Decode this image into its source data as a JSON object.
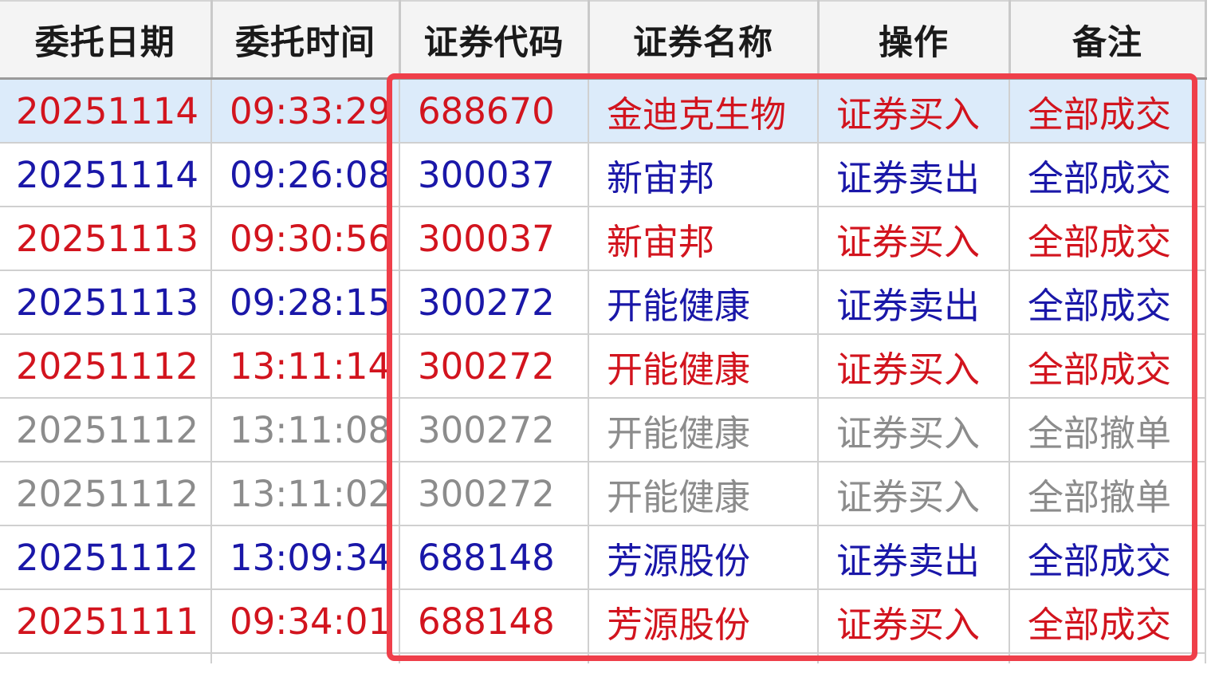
{
  "table": {
    "headers": [
      "委托日期",
      "委托时间",
      "证券代码",
      "证券名称",
      "操作",
      "备注"
    ],
    "rows": [
      {
        "date": "20251114",
        "time": "09:33:29",
        "code": "688670",
        "name": "金迪克生物",
        "action": "证券买入",
        "remark": "全部成交",
        "color": "red",
        "selected": true
      },
      {
        "date": "20251114",
        "time": "09:26:08",
        "code": "300037",
        "name": "新宙邦",
        "action": "证券卖出",
        "remark": "全部成交",
        "color": "blue"
      },
      {
        "date": "20251113",
        "time": "09:30:56",
        "code": "300037",
        "name": "新宙邦",
        "action": "证券买入",
        "remark": "全部成交",
        "color": "red"
      },
      {
        "date": "20251113",
        "time": "09:28:15",
        "code": "300272",
        "name": "开能健康",
        "action": "证券卖出",
        "remark": "全部成交",
        "color": "blue"
      },
      {
        "date": "20251112",
        "time": "13:11:14",
        "code": "300272",
        "name": "开能健康",
        "action": "证券买入",
        "remark": "全部成交",
        "color": "red"
      },
      {
        "date": "20251112",
        "time": "13:11:08",
        "code": "300272",
        "name": "开能健康",
        "action": "证券买入",
        "remark": "全部撤单",
        "color": "gray"
      },
      {
        "date": "20251112",
        "time": "13:11:02",
        "code": "300272",
        "name": "开能健康",
        "action": "证券买入",
        "remark": "全部撤单",
        "color": "gray"
      },
      {
        "date": "20251112",
        "time": "13:09:34",
        "code": "688148",
        "name": "芳源股份",
        "action": "证券卖出",
        "remark": "全部成交",
        "color": "blue"
      },
      {
        "date": "20251111",
        "time": "09:34:01",
        "code": "688148",
        "name": "芳源股份",
        "action": "证券买入",
        "remark": "全部成交",
        "color": "red"
      }
    ]
  },
  "colors": {
    "buy_red": "#d2141e",
    "sell_blue": "#1a17a8",
    "cancel_gray": "#8c8c8c",
    "selected_row_bg": "#dcebfa",
    "highlight_frame": "#ef3f4a"
  }
}
